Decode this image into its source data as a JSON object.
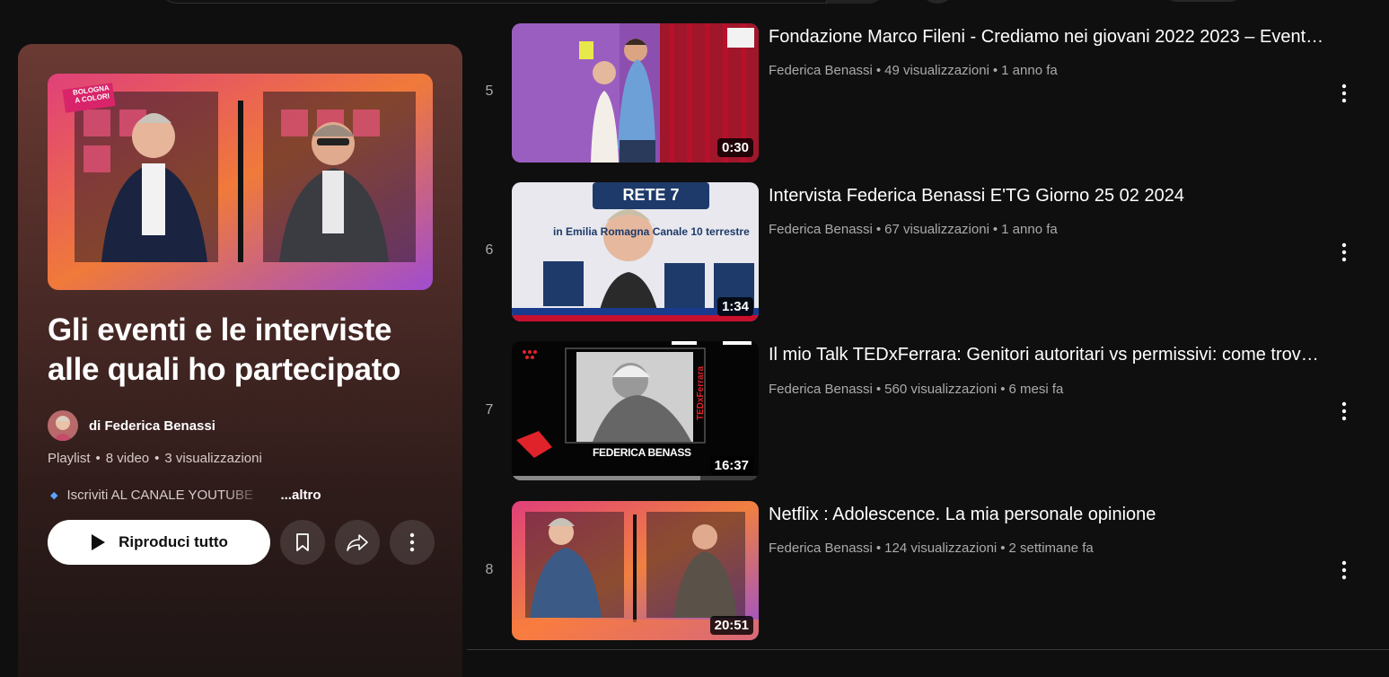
{
  "playlist": {
    "title": "Gli eventi e le interviste alle quali ho partecipato",
    "owner": "di Federica Benassi",
    "type": "Playlist",
    "video_count": "8 video",
    "views": "3 visualizzazioni",
    "description": "Iscriviti AL CANALE YOUTUBE",
    "more_label": "...altro",
    "play_all_label": "Riproduci tutto",
    "cover_badge": "BOLOGNA A COLORI"
  },
  "videos": [
    {
      "index": "5",
      "title": "Fondazione Marco Fileni - Crediamo nei giovani 2022 2023 – Evento finale",
      "channel": "Federica Benassi",
      "views": "49 visualizzazioni",
      "age": "1 anno fa",
      "duration": "0:30"
    },
    {
      "index": "6",
      "title": "Intervista Federica Benassi E'TG Giorno 25 02 2024",
      "channel": "Federica Benassi",
      "views": "67 visualizzazioni",
      "age": "1 anno fa",
      "duration": "1:34",
      "thumb_text": "in Emilia Romagna Canale 10 terrestre",
      "thumb_logo": "RETE 7"
    },
    {
      "index": "7",
      "title": "Il mio Talk TEDxFerrara: Genitori autoritari vs permissivi: come trovare l'equilibrio",
      "channel": "Federica Benassi",
      "views": "560 visualizzazioni",
      "age": "6 mesi fa",
      "duration": "16:37",
      "thumb_name": "FEDERICA BENASS",
      "thumb_brand": "TEDxFerrara"
    },
    {
      "index": "8",
      "title": "Netflix : Adolescence. La mia personale opinione",
      "channel": "Federica Benassi",
      "views": "124 visualizzazioni",
      "age": "2 settimane fa",
      "duration": "20:51"
    }
  ],
  "colors": {
    "background": "#0f0f0f",
    "panel_top": "#6a3a33",
    "meta_text": "#aaaaaa"
  }
}
